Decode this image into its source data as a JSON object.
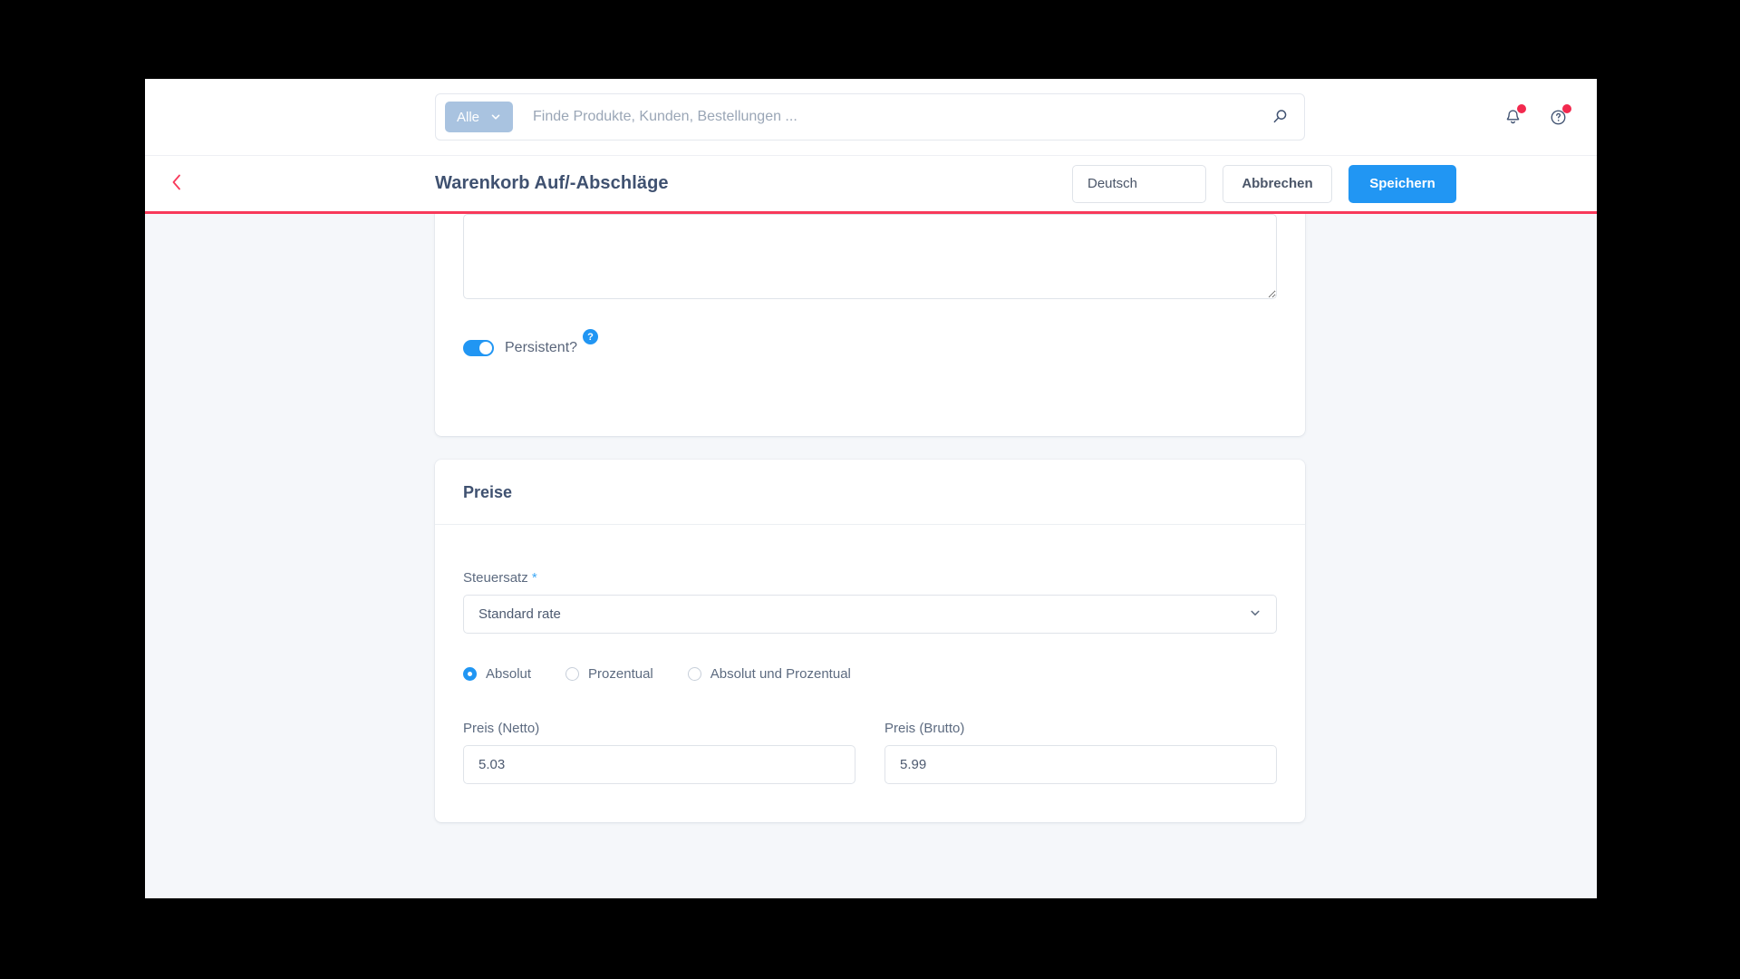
{
  "topbar": {
    "scope_label": "Alle",
    "search_placeholder": "Finde Produkte, Kunden, Bestellungen ...",
    "search_value": "",
    "search_icon": "search-icon",
    "notifications_icon": "bell-icon",
    "help_icon": "help-circle-icon"
  },
  "header": {
    "back_icon": "chevron-left-icon",
    "title": "Warenkorb Auf/-Abschläge",
    "language_value": "Deutsch",
    "cancel_label": "Abbrechen",
    "save_label": "Speichern"
  },
  "details_card": {
    "description_value": "",
    "description_placeholder": "",
    "persistent_label": "Persistent?",
    "persistent_state": "on",
    "help_badge_label": "?"
  },
  "prices_card": {
    "title": "Preise",
    "tax_rate_label": "Steuersatz",
    "tax_rate_required_mark": "*",
    "tax_rate_value": "Standard rate",
    "discount_type_options": [
      {
        "label": "Absolut",
        "selected": true
      },
      {
        "label": "Prozentual",
        "selected": false
      },
      {
        "label": "Absolut und Prozentual",
        "selected": false
      }
    ],
    "price_net_label": "Preis (Netto)",
    "price_net_value": "5.03",
    "price_gross_label": "Preis (Brutto)",
    "price_gross_value": "5.99"
  },
  "colors": {
    "accent_blue": "#2196f3",
    "accent_red": "#f8395a",
    "scope_chip": "#a9c3e0",
    "badge_dot": "#f2294e",
    "page_bg": "#f5f7fa"
  }
}
